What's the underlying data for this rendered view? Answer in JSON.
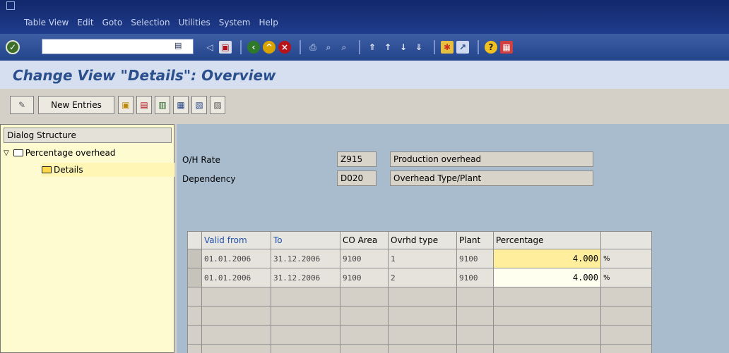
{
  "menu": {
    "items": [
      "Table View",
      "Edit",
      "Goto",
      "Selection",
      "Utilities",
      "System",
      "Help"
    ]
  },
  "toolbar": {
    "command_value": "",
    "icons": [
      "ok-icon",
      "command-field",
      "back-icon",
      "save-icon",
      "back-green-icon",
      "exit-icon",
      "cancel-icon",
      "print-icon",
      "find-icon",
      "find-next-icon",
      "first-page-icon",
      "prev-page-icon",
      "next-page-icon",
      "last-page-icon",
      "create-session-icon",
      "shortcut-icon",
      "help-icon",
      "layout-icon"
    ]
  },
  "title": "Change View \"Details\": Overview",
  "app_toolbar": {
    "new_entries_label": "New Entries"
  },
  "dialog": {
    "header": "Dialog Structure",
    "items": [
      {
        "label": "Percentage overhead"
      },
      {
        "label": "Details"
      }
    ]
  },
  "header_fields": {
    "oh_rate_label": "O/H Rate",
    "oh_rate_value": "Z915",
    "oh_rate_text": "Production overhead",
    "dependency_label": "Dependency",
    "dependency_value": "D020",
    "dependency_text": "Overhead Type/Plant"
  },
  "table": {
    "columns": [
      "Valid from",
      "To",
      "CO Area",
      "Ovrhd type",
      "Plant",
      "Percentage"
    ],
    "rows": [
      {
        "valid_from": "01.01.2006",
        "to": "31.12.2006",
        "co_area": "9100",
        "ovrhd_type": "1",
        "plant": "9100",
        "percentage": "4.000",
        "unit": "%"
      },
      {
        "valid_from": "01.01.2006",
        "to": "31.12.2006",
        "co_area": "9100",
        "ovrhd_type": "2",
        "plant": "9100",
        "percentage": "4.000",
        "unit": "%"
      }
    ]
  }
}
